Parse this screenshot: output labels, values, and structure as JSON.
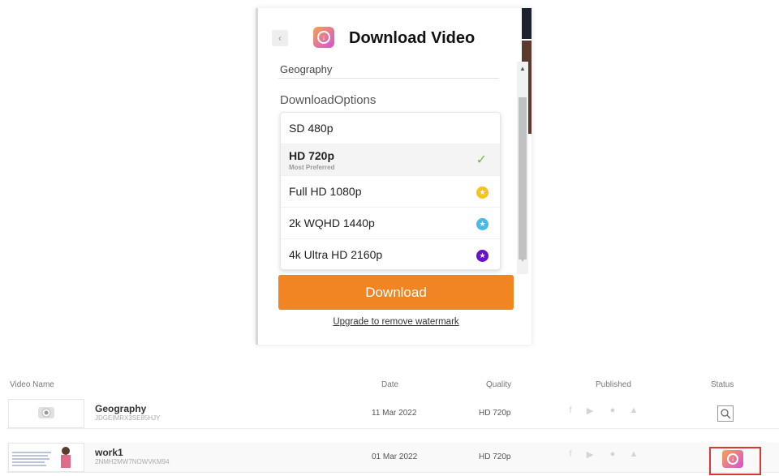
{
  "panel": {
    "back_icon": "chevron-left-icon",
    "title": "Download Video",
    "video_name": "Geography",
    "options_label": "DownloadOptions",
    "options": [
      {
        "label": "SD 480p",
        "sub": "",
        "badge": "none"
      },
      {
        "label": "HD 720p",
        "sub": "Most Preferred",
        "badge": "check",
        "selected": true
      },
      {
        "label": "Full HD 1080p",
        "sub": "",
        "badge": "star",
        "badge_color": "#f5c518"
      },
      {
        "label": "2k WQHD 1440p",
        "sub": "",
        "badge": "star",
        "badge_color": "#4ab8ea"
      },
      {
        "label": "4k Ultra HD 2160p",
        "sub": "",
        "badge": "star",
        "badge_color": "#6a11cb"
      }
    ],
    "download_label": "Download",
    "upgrade_label": "Upgrade to remove watermark",
    "accent_color": "#f08521"
  },
  "table": {
    "headers": {
      "name": "Video Name",
      "date": "Date",
      "quality": "Quality",
      "published": "Published",
      "status": "Status"
    },
    "rows": [
      {
        "name": "Geography",
        "code": "JDGEIMRX3SE85HJY",
        "date": "11 Mar 2022",
        "quality": "HD 720p",
        "status": "search-icon"
      },
      {
        "name": "work1",
        "code": "2NMH2MW7NOWVKM94",
        "date": "01 Mar 2022",
        "quality": "HD 720p",
        "status": "download-icon"
      }
    ],
    "published_icons": [
      "facebook-icon",
      "youtube-icon",
      "twitter-icon",
      "share-icon"
    ]
  }
}
